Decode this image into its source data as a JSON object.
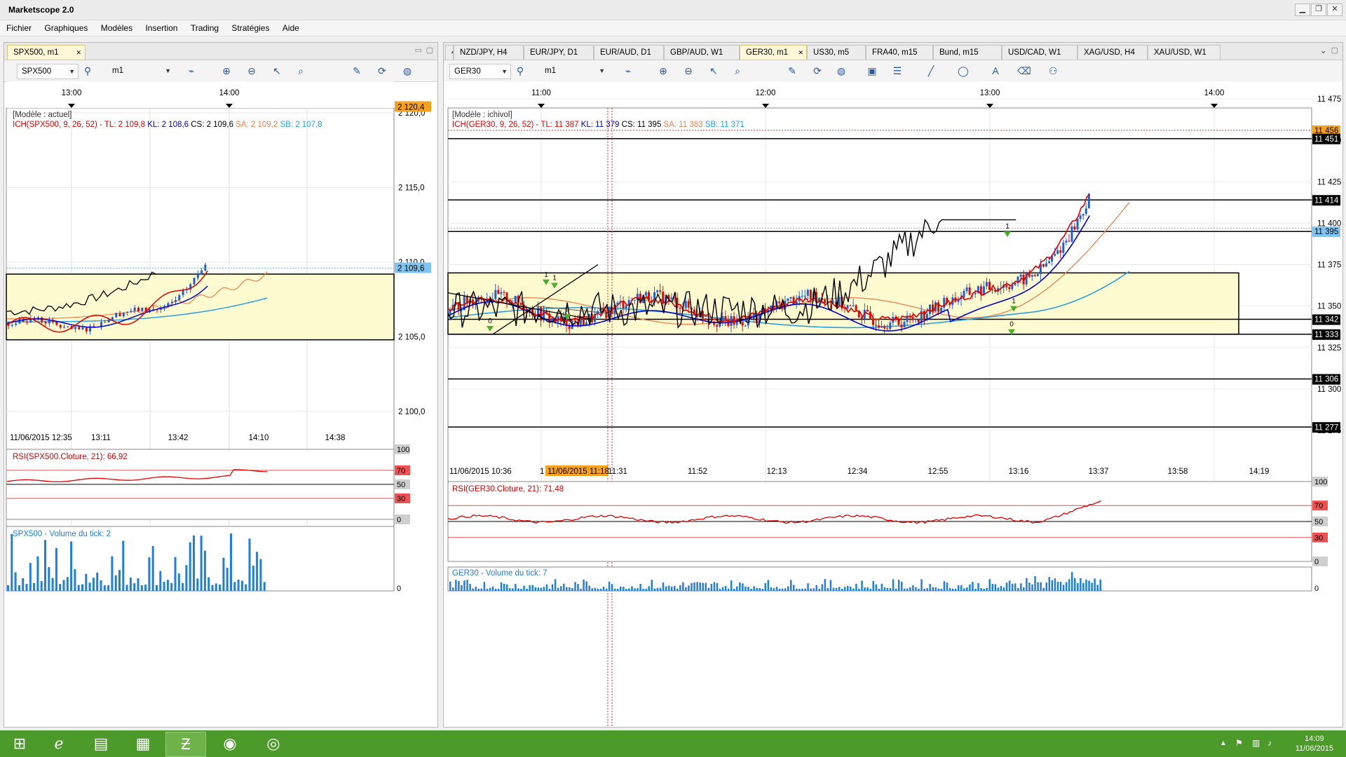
{
  "window": {
    "title": "Marketscope 2.0"
  },
  "menu": [
    "Fichier",
    "Graphiques",
    "Modèles",
    "Insertion",
    "Trading",
    "Stratégies",
    "Aide"
  ],
  "left_panel": {
    "tab": "SPX500, m1",
    "tab_close": "✕",
    "symbol": "SPX500",
    "timeframe": "m1",
    "top_times": [
      "13:00",
      "14:00"
    ],
    "model": "[Modèle : actuel]",
    "ich_prefix": "ICH(SPX500, 9, 26, 52) -",
    "ich_tl": "TL: 2 109,8",
    "ich_kl": "KL: 2 108,6",
    "ich_cs": "CS: 2 109,6",
    "ich_sa": "SA: 2 109,2",
    "ich_sb": "SB: 2 107,8",
    "price_labels": [
      "2 120,0",
      "2 115,0",
      "2 110,0",
      "2 105,0",
      "2 100,0"
    ],
    "price_tag_top": "2 120,4",
    "price_tag_current": "2 109,6",
    "bottom_times": [
      "11/06/2015 12:35",
      "13:11",
      "13:42",
      "14:10",
      "14:38"
    ],
    "rsi_label": "RSI(SPX500.Cloture, 21): 66,92",
    "rsi_levels": [
      "100",
      "70",
      "50",
      "30",
      "0"
    ],
    "volume_label": "SPX500 - Volume du tick: 2",
    "volume_zero": "0"
  },
  "right_panel": {
    "tabs": [
      "4",
      "NZD/JPY, H4",
      "EUR/JPY, D1",
      "EUR/AUD, D1",
      "GBP/AUD, W1",
      "GER30, m1",
      "US30, m5",
      "FRA40, m15",
      "Bund, m15",
      "USD/CAD, W1",
      "XAG/USD, H4",
      "XAU/USD, W1"
    ],
    "active_tab": "GER30, m1",
    "tab_close": "✕",
    "symbol": "GER30",
    "timeframe": "m1",
    "top_times": [
      "11:00",
      "12:00",
      "13:00",
      "14:00"
    ],
    "model": "[Modèle : ichivol]",
    "ich_prefix": "ICH(GER30, 9, 26, 52) -",
    "ich_tl": "TL: 11 387",
    "ich_kl": "KL: 11 379",
    "ich_cs": "CS: 11 395",
    "ich_sa": "SA: 11 383",
    "ich_sb": "SB: 11 371",
    "price_labels": [
      "11 475",
      "11 450",
      "11 425",
      "11 400",
      "11 375",
      "11 350",
      "11 325",
      "11 300",
      "11 275"
    ],
    "level_tags": [
      "11 456",
      "11 451",
      "11 414",
      "11 395",
      "11 342",
      "11 333",
      "11 306",
      "11 277"
    ],
    "bottom_times": [
      "11/06/2015 10:36",
      "11:31",
      "11:52",
      "12:13",
      "12:34",
      "12:55",
      "13:16",
      "13:37",
      "13:58",
      "14:19"
    ],
    "cursor_time": "11/06/2015 11:18",
    "cursor_prefix": "1",
    "signal_labels": [
      "0",
      "1",
      "0",
      "1",
      "1",
      "0",
      "1"
    ],
    "rsi_label": "RSI(GER30.Cloture, 21): 71,48",
    "rsi_levels": [
      "100",
      "70",
      "50",
      "30",
      "0"
    ],
    "volume_label": "GER30 - Volume du tick: 7",
    "volume_zero": "0"
  },
  "taskbar": {
    "apps": [
      "windows-start",
      "internet-explorer",
      "file-explorer",
      "store",
      "marketscope",
      "firefox",
      "chrome"
    ],
    "time": "14:09",
    "date": "11/06/2015"
  },
  "colors": {
    "cloud": "#fffbd0",
    "tenkan": "#e00000",
    "kijun": "#0000d0",
    "chikou": "#000000",
    "senkou_a": "#f08050",
    "senkou_b": "#2aa0e0",
    "rsi": "#e00000",
    "volume": "#1f7ee0",
    "taskbar": "#4c9a2a",
    "cursor_tag": "#f7a21d"
  }
}
